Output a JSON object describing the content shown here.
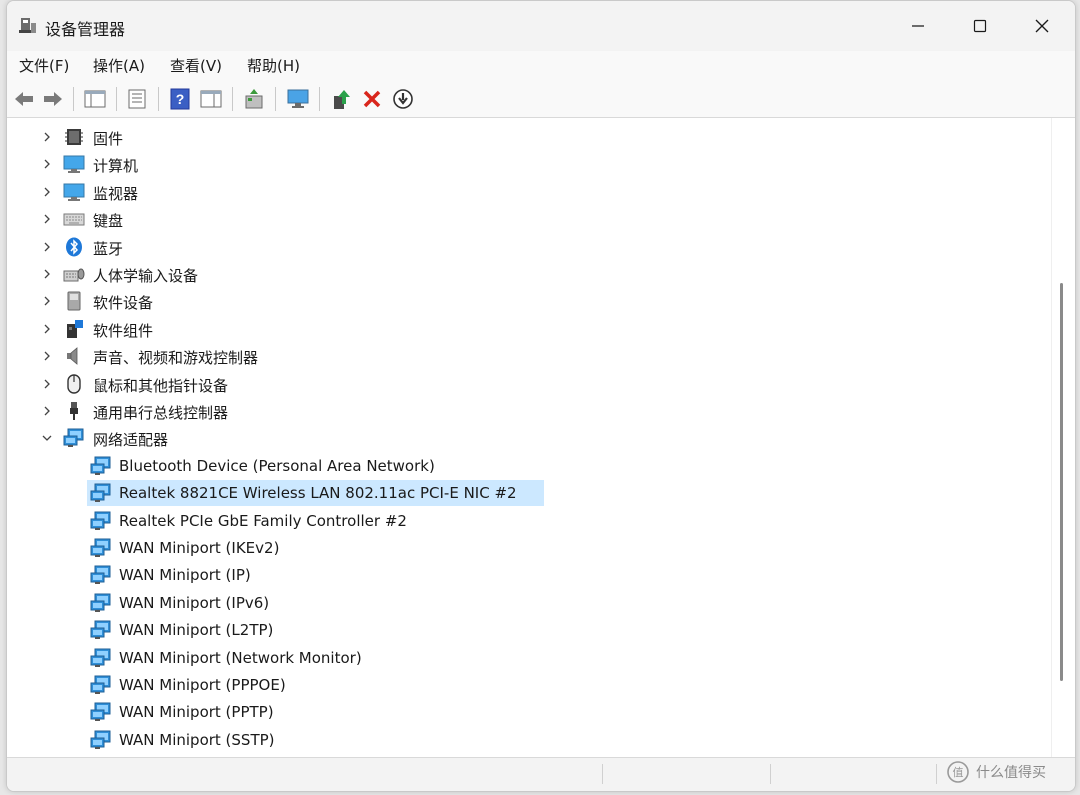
{
  "window": {
    "title": "设备管理器",
    "controls": [
      "minimize",
      "maximize",
      "close"
    ]
  },
  "menu": {
    "items": [
      "文件(F)",
      "操作(A)",
      "查看(V)",
      "帮助(H)"
    ]
  },
  "toolbar": {
    "buttons": [
      "back-arrow-icon",
      "forward-arrow-icon",
      "show-hide-console-tree-icon",
      "properties-icon",
      "help-icon",
      "action-pane-icon",
      "scan-hardware-icon",
      "monitor-icon",
      "update-driver-icon",
      "uninstall-icon",
      "disable-device-icon"
    ]
  },
  "tree": {
    "categories": [
      {
        "label": "固件",
        "icon": "firmware-icon",
        "expanded": false
      },
      {
        "label": "计算机",
        "icon": "computer-icon",
        "expanded": false
      },
      {
        "label": "监视器",
        "icon": "monitor-icon",
        "expanded": false
      },
      {
        "label": "键盘",
        "icon": "keyboard-icon",
        "expanded": false
      },
      {
        "label": "蓝牙",
        "icon": "bluetooth-icon",
        "expanded": false
      },
      {
        "label": "人体学输入设备",
        "icon": "hid-icon",
        "expanded": false
      },
      {
        "label": "软件设备",
        "icon": "software-device-icon",
        "expanded": false
      },
      {
        "label": "软件组件",
        "icon": "software-component-icon",
        "expanded": false
      },
      {
        "label": "声音、视频和游戏控制器",
        "icon": "speaker-icon",
        "expanded": false
      },
      {
        "label": "鼠标和其他指针设备",
        "icon": "mouse-icon",
        "expanded": false
      },
      {
        "label": "通用串行总线控制器",
        "icon": "usb-icon",
        "expanded": false
      },
      {
        "label": "网络适配器",
        "icon": "network-adapter-icon",
        "expanded": true
      }
    ],
    "network_adapters": [
      {
        "label": "Bluetooth Device (Personal Area Network)",
        "selected": false
      },
      {
        "label": "Realtek 8821CE Wireless LAN 802.11ac PCI-E NIC #2",
        "selected": true
      },
      {
        "label": "Realtek PCIe GbE Family Controller #2",
        "selected": false
      },
      {
        "label": "WAN Miniport (IKEv2)",
        "selected": false
      },
      {
        "label": "WAN Miniport (IP)",
        "selected": false
      },
      {
        "label": "WAN Miniport (IPv6)",
        "selected": false
      },
      {
        "label": "WAN Miniport (L2TP)",
        "selected": false
      },
      {
        "label": "WAN Miniport (Network Monitor)",
        "selected": false
      },
      {
        "label": "WAN Miniport (PPPOE)",
        "selected": false
      },
      {
        "label": "WAN Miniport (PPTP)",
        "selected": false
      },
      {
        "label": "WAN Miniport (SSTP)",
        "selected": false
      }
    ]
  },
  "watermark": {
    "text": "什么值得买"
  },
  "colors": {
    "selection": "#cce8ff",
    "network_icon": "#2f8fd8",
    "delete_red": "#d9261c",
    "green_arrow": "#2aa14a"
  }
}
